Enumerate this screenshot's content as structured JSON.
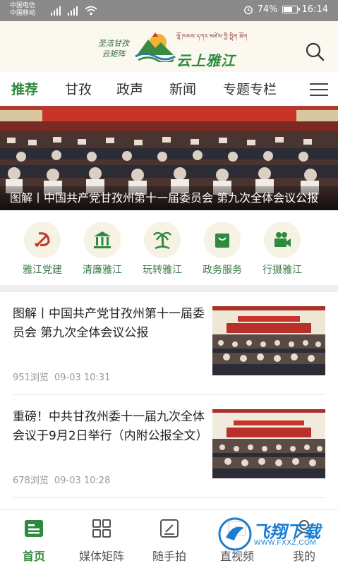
{
  "status_bar": {
    "carrier1": "中国电信",
    "carrier2": "中国移动",
    "battery": "74%",
    "battery_level": 0.74,
    "time": "16:14"
  },
  "header": {
    "slogan_line1": "圣洁甘孜",
    "slogan_line2": "云矩阵",
    "brand_tibetan": "ལྷོ་ཁམས་དཀར་མཛེས་ཀྱི་སྤྲིན་ཐོག",
    "brand_name": "云上雅江",
    "logo_icon": "mountain-sun-logo",
    "search_icon": "search-icon"
  },
  "nav": {
    "tabs": [
      {
        "label": "推荐",
        "active": true
      },
      {
        "label": "甘孜",
        "active": false
      },
      {
        "label": "政声",
        "active": false
      },
      {
        "label": "新闻",
        "active": false
      },
      {
        "label": "专题专栏",
        "active": false
      }
    ],
    "menu_icon": "hamburger-icon"
  },
  "banner": {
    "caption": "图解丨中国共产党甘孜州第十一届委员会 第九次全体会议公报"
  },
  "quick_menu": [
    {
      "label": "雅江党建",
      "icon": "party-emblem-icon"
    },
    {
      "label": "清廉雅江",
      "icon": "building-icon"
    },
    {
      "label": "玩转雅江",
      "icon": "palm-tree-icon"
    },
    {
      "label": "政务服务",
      "icon": "shopping-bag-icon"
    },
    {
      "label": "行摄雅江",
      "icon": "video-camera-icon"
    }
  ],
  "articles": [
    {
      "title": "图解丨中国共产党甘孜州第十一届委员会 第九次全体会议公报",
      "views": "951浏览",
      "date": "09-03 10:31"
    },
    {
      "title": "重磅！中共甘孜州委十一届九次全体会议于9月2日举行（内附公报全文）",
      "views": "678浏览",
      "date": "09-03 10:28"
    }
  ],
  "bottom_nav": [
    {
      "label": "首页",
      "icon": "home-news-icon",
      "active": true
    },
    {
      "label": "媒体矩阵",
      "icon": "grid-icon",
      "active": false
    },
    {
      "label": "随手拍",
      "icon": "camera-edit-icon",
      "active": false
    },
    {
      "label": "直视频",
      "icon": "video-icon",
      "active": false
    },
    {
      "label": "我的",
      "icon": "user-icon",
      "active": false
    }
  ],
  "watermark": {
    "text": "飞翔下载",
    "url": "WWW.FXXZ.COM"
  },
  "colors": {
    "accent": "#2f8a3f",
    "status_bar": "#8a8a8a",
    "header_bg": "#fbf8ef"
  }
}
